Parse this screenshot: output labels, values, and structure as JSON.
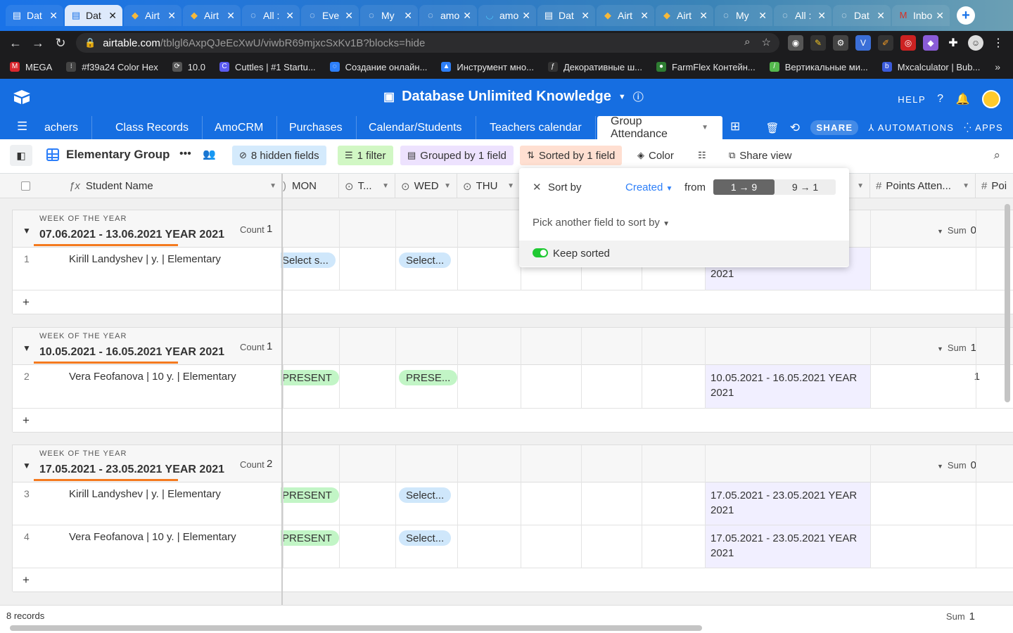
{
  "browser": {
    "tabs": [
      {
        "label": "Dat",
        "icon": "airtable-icon",
        "active": false
      },
      {
        "label": "Dat",
        "icon": "airtable-icon",
        "active": true
      },
      {
        "label": "Airt",
        "icon": "airtable-logo-icon",
        "active": false
      },
      {
        "label": "Airt",
        "icon": "airtable-logo-icon",
        "active": false
      },
      {
        "label": "All :",
        "icon": "loading-icon",
        "active": false
      },
      {
        "label": "Eve",
        "icon": "loading-icon",
        "active": false
      },
      {
        "label": "My",
        "icon": "loading-icon",
        "active": false
      },
      {
        "label": "amo",
        "icon": "loading-icon",
        "active": false
      },
      {
        "label": "amo",
        "icon": "amocrm-icon",
        "active": false
      },
      {
        "label": "Dat",
        "icon": "airtable-icon",
        "active": false
      },
      {
        "label": "Airt",
        "icon": "airtable-logo-icon",
        "active": false
      },
      {
        "label": "Airt",
        "icon": "airtable-logo-icon",
        "active": false
      },
      {
        "label": "My",
        "icon": "loading-icon",
        "active": false
      },
      {
        "label": "All :",
        "icon": "loading-icon",
        "active": false
      },
      {
        "label": "Dat",
        "icon": "loading-icon",
        "active": false
      },
      {
        "label": "Inbo",
        "icon": "gmail-icon",
        "active": false
      }
    ],
    "url_host": "airtable.com",
    "url_path": "/tblgl6AxpQJeEcXwU/viwbR69mjxcSxKv1B?blocks=hide",
    "bookmarks": [
      {
        "label": "MEGA",
        "color": "#d9272e",
        "glyph": "M"
      },
      {
        "label": "#f39a24 Color Hex",
        "color": "#444444",
        "glyph": "⁝"
      },
      {
        "label": "10.0",
        "color": "#555555",
        "glyph": "⟳"
      },
      {
        "label": "Cuttles | #1 Startu...",
        "color": "#5b5bf0",
        "glyph": "C"
      },
      {
        "label": "Создание онлайн...",
        "color": "#2d7ff9",
        "glyph": "◌"
      },
      {
        "label": "Инструмент мно...",
        "color": "#2d7ff9",
        "glyph": "▲"
      },
      {
        "label": "Декоративные ш...",
        "color": "#333333",
        "glyph": "ƒ"
      },
      {
        "label": "FarmFlex Контейн...",
        "color": "#2e7d32",
        "glyph": "●"
      },
      {
        "label": "Вертикальные ми...",
        "color": "#55b84e",
        "glyph": "/"
      },
      {
        "label": "Mxcalculator | Bub...",
        "color": "#3b5bdb",
        "glyph": "b"
      }
    ]
  },
  "app": {
    "base_title": "Database Unlimited Knowledge",
    "help_label": "HELP",
    "tables": [
      "achers",
      "Class Records",
      "AmoCRM",
      "Purchases",
      "Calendar/Students",
      "Teachers calendar",
      "Group Attendance"
    ],
    "share_label": "SHARE",
    "automations_label": "AUTOMATIONS",
    "apps_label": "APPS"
  },
  "viewbar": {
    "view_name": "Elementary Group",
    "hidden_fields": "8 hidden fields",
    "filter": "1 filter",
    "grouped": "Grouped by 1 field",
    "sorted": "Sorted by 1 field",
    "color": "Color",
    "share_view": "Share view"
  },
  "columns": {
    "primary": "Student Name",
    "mon": "MON",
    "tue": "T...",
    "wed": "WED",
    "thu": "THU",
    "points": "Points Atten...",
    "poi": "Poi"
  },
  "groups": [
    {
      "label": "WEEK OF THE YEAR",
      "value": "07.06.2021 - 13.06.2021 YEAR 2021",
      "count_label": "Count",
      "count": "1",
      "sum_label": "Sum",
      "sum": "0",
      "rows": [
        {
          "num": "1",
          "name": "Kirill Landyshev |  y. | Elementary",
          "mon": "Select s...",
          "mon_style": "blue",
          "wed": "Select...",
          "wed_style": "blue",
          "week": "2021",
          "points": ""
        }
      ]
    },
    {
      "label": "WEEK OF THE YEAR",
      "value": "10.05.2021 - 16.05.2021 YEAR 2021",
      "count_label": "Count",
      "count": "1",
      "sum_label": "Sum",
      "sum": "1",
      "rows": [
        {
          "num": "2",
          "name": "Vera Feofanova | 10 y. | Elementary",
          "mon": "PRESENT",
          "mon_style": "green",
          "wed": "PRESE...",
          "wed_style": "green",
          "week": "10.05.2021 - 16.05.2021 YEAR 2021",
          "points": "1"
        }
      ]
    },
    {
      "label": "WEEK OF THE YEAR",
      "value": "17.05.2021 - 23.05.2021 YEAR 2021",
      "count_label": "Count",
      "count": "2",
      "sum_label": "Sum",
      "sum": "0",
      "rows": [
        {
          "num": "3",
          "name": "Kirill Landyshev |  y. | Elementary",
          "mon": "PRESENT",
          "mon_style": "green",
          "wed": "Select...",
          "wed_style": "blue",
          "week": "17.05.2021 - 23.05.2021 YEAR 2021",
          "points": ""
        },
        {
          "num": "4",
          "name": "Vera Feofanova | 10 y. | Elementary",
          "mon": "PRESENT",
          "mon_style": "green",
          "wed": "Select...",
          "wed_style": "blue",
          "week": "17.05.2021 - 23.05.2021 YEAR 2021",
          "points": ""
        }
      ]
    }
  ],
  "sort_popup": {
    "sort_by": "Sort by",
    "field": "Created",
    "from": "from",
    "asc": "1 → 9",
    "desc": "9 → 1",
    "pick_another": "Pick another field to sort by",
    "keep_sorted": "Keep sorted"
  },
  "footer": {
    "records": "8 records",
    "sum_label": "Sum",
    "sum": "1"
  },
  "colors": {
    "brand_blue": "#166ee1",
    "group_underline": "#f47a1f",
    "chip_green": "#c2f5c6",
    "chip_blue": "#cfe7fb",
    "toggle_on": "#20c933"
  }
}
